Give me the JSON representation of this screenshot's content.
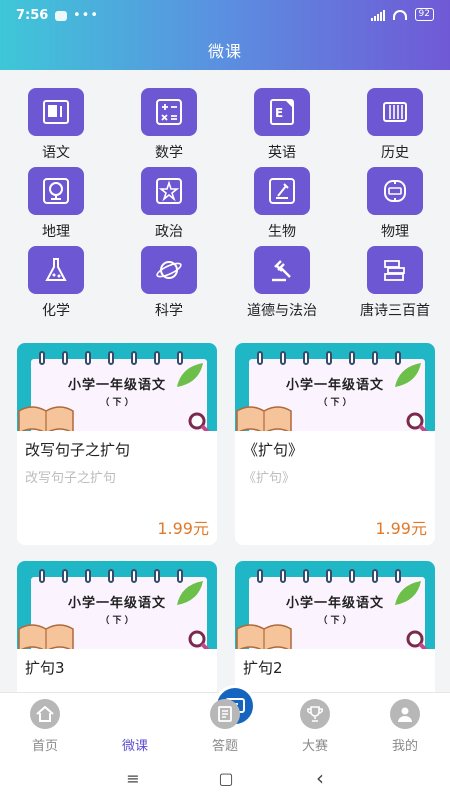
{
  "status": {
    "time": "7:56",
    "dots": "•••",
    "battery": "92"
  },
  "header": {
    "title": "微课"
  },
  "categories": [
    {
      "label": "语文",
      "icon": "book-icon"
    },
    {
      "label": "数学",
      "icon": "math-symbols-icon"
    },
    {
      "label": "英语",
      "icon": "english-book-icon"
    },
    {
      "label": "历史",
      "icon": "scroll-icon"
    },
    {
      "label": "地理",
      "icon": "globe-icon"
    },
    {
      "label": "政治",
      "icon": "star-badge-icon"
    },
    {
      "label": "生物",
      "icon": "microscope-icon"
    },
    {
      "label": "物理",
      "icon": "atom-icon"
    },
    {
      "label": "化学",
      "icon": "flask-icon"
    },
    {
      "label": "科学",
      "icon": "planet-icon"
    },
    {
      "label": "道德与法治",
      "icon": "gavel-icon"
    },
    {
      "label": "唐诗三百首",
      "icon": "books-stack-icon"
    }
  ],
  "cards": [
    {
      "cover_title": "小学一年级语文",
      "cover_sub": "（ 下 ）",
      "title": "改写句子之扩句",
      "subtitle": "改写句子之扩句",
      "price": "1.99元"
    },
    {
      "cover_title": "小学一年级语文",
      "cover_sub": "（ 下 ）",
      "title": "《扩句》",
      "subtitle": "《扩句》",
      "price": "1.99元"
    },
    {
      "cover_title": "小学一年级语文",
      "cover_sub": "（ 下 ）",
      "title": "扩句3",
      "subtitle": "",
      "price": ""
    },
    {
      "cover_title": "小学一年级语文",
      "cover_sub": "（ 下 ）",
      "title": "扩句2",
      "subtitle": "",
      "price": ""
    }
  ],
  "tabs": [
    {
      "label": "首页",
      "icon": "home-icon"
    },
    {
      "label": "微课",
      "icon": "micro-lesson-icon"
    },
    {
      "label": "答题",
      "icon": "quiz-icon"
    },
    {
      "label": "大赛",
      "icon": "trophy-icon"
    },
    {
      "label": "我的",
      "icon": "user-icon"
    }
  ],
  "nav": {
    "menu": "≡",
    "home": "▢",
    "back": "‹"
  },
  "colors": {
    "accent": "#6e57d2",
    "price": "#e07a2a",
    "active_tab": "#5e4fd0",
    "cover_bg": "#1fb6c6"
  }
}
